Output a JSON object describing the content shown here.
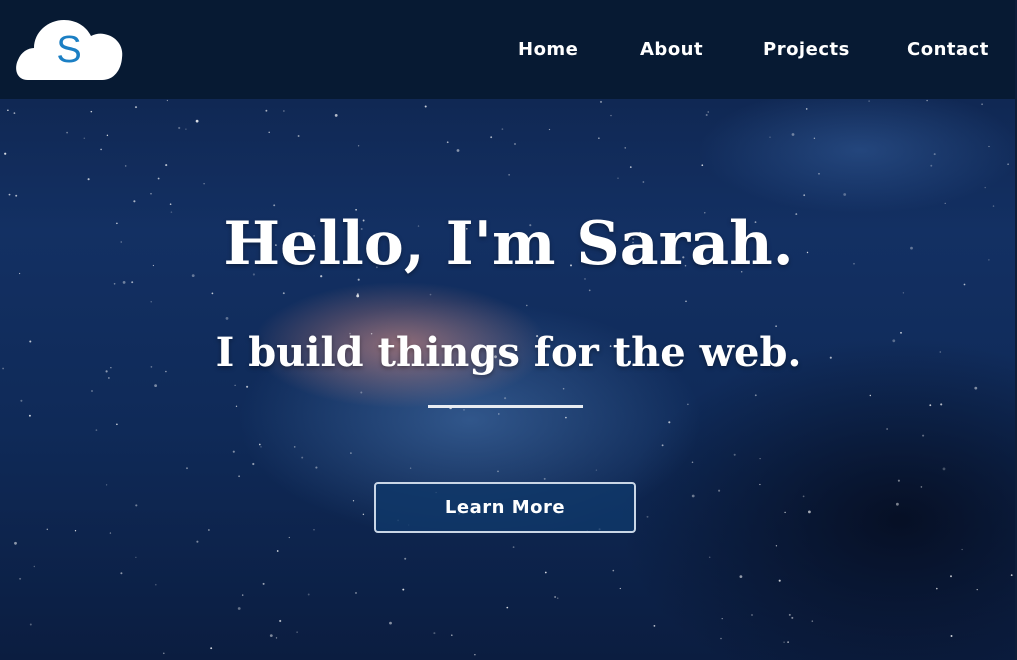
{
  "logo": {
    "letter": "S",
    "icon": "cloud-icon",
    "color": "#1b7fc4"
  },
  "nav": {
    "items": [
      {
        "label": "Home"
      },
      {
        "label": "About"
      },
      {
        "label": "Projects"
      },
      {
        "label": "Contact"
      }
    ]
  },
  "hero": {
    "headline": "Hello, I'm Sarah.",
    "subline": "I build things for the web.",
    "cta_label": "Learn More"
  },
  "colors": {
    "navbar": "#071a33",
    "sky": "#133063",
    "text": "#ffffff"
  }
}
